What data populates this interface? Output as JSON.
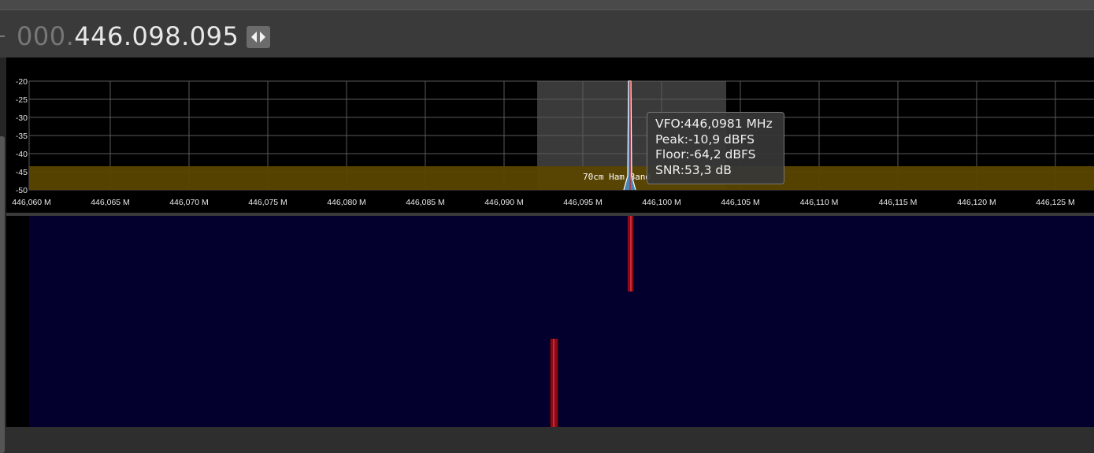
{
  "frequency": {
    "dim_prefix": "000.",
    "value": "446.098.095"
  },
  "toolbar": {
    "swap_icon": "left-right-arrows-icon"
  },
  "spectrum": {
    "y_ticks": [
      "-20",
      "-25",
      "-30",
      "-35",
      "-40",
      "-45",
      "-50"
    ],
    "x_ticks": [
      "446,060 M",
      "446,065 M",
      "446,070 M",
      "446,075 M",
      "446,080 M",
      "446,085 M",
      "446,090 M",
      "446,095 M",
      "446,100 M",
      "446,105 M",
      "446,110 M",
      "446,115 M",
      "446,120 M",
      "446,125 M"
    ],
    "band_label": "70cm Ham Band",
    "colors": {
      "band": "#5a4500",
      "grid": "#5a5a5a",
      "passband": "#3a3a3a",
      "signal": "#ffffff",
      "tuning_line": "#d02020"
    }
  },
  "tooltip": {
    "vfo": "VFO:446,0981 MHz",
    "peak": "Peak:-10,9 dBFS",
    "floor": "Floor:-64,2 dBFS",
    "snr": "SNR:53,3 dB"
  },
  "waterfall": {
    "background": "#04002e",
    "trace_color": "#c92a35"
  }
}
